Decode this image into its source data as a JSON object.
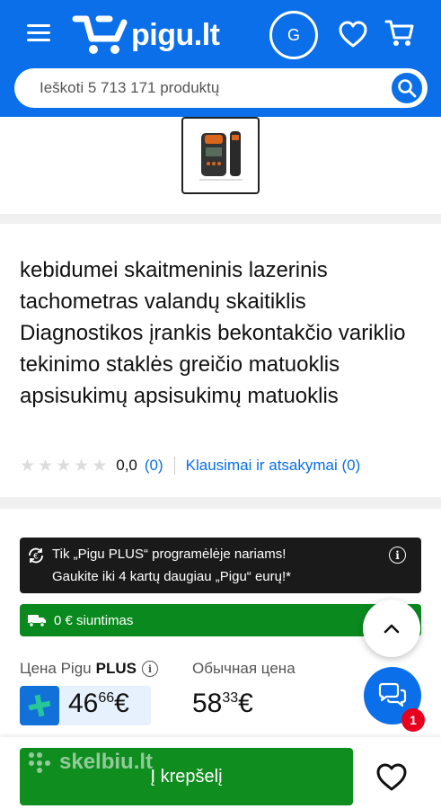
{
  "header": {
    "logo_text": "pigu.lt",
    "avatar_letter": "G",
    "search_placeholder": "Ieškoti 5 713 171 produktų"
  },
  "product": {
    "title": "kebidumei skaitmeninis lazerinis tachometras valandų skaitiklis Diagnostikos įrankis bekontakčio variklio tekinimo staklės greičio matuoklis apsisukimų apsisukimų matuoklis",
    "rating_value": "0,0",
    "rating_count": "(0)",
    "qa_link": "Klausimai ir atsakymai (0)"
  },
  "promo": {
    "line1": "Tik „Pigu PLUS“ programėlėje nariams!",
    "line2": "Gaukite iki 4 kartų daugiau „Pigu“ eurų!*",
    "shipping": "0 € siuntimas"
  },
  "prices": {
    "plus_label": "Цена Pigu",
    "plus_label_bold": "PLUS",
    "plus_int": "46",
    "plus_cents": "66",
    "currency": "€",
    "regular_label": "Обычная цена",
    "regular_int": "58",
    "regular_cents": "33"
  },
  "bottom": {
    "add_to_cart": "Į krepšelį",
    "watermark": "skelbiu.lt"
  },
  "chat": {
    "badge": "1"
  },
  "colors": {
    "brand_blue": "#0a6fe8",
    "green": "#0f8d1f",
    "dark_banner": "#1a1a1a",
    "badge_red": "#e8001c"
  }
}
